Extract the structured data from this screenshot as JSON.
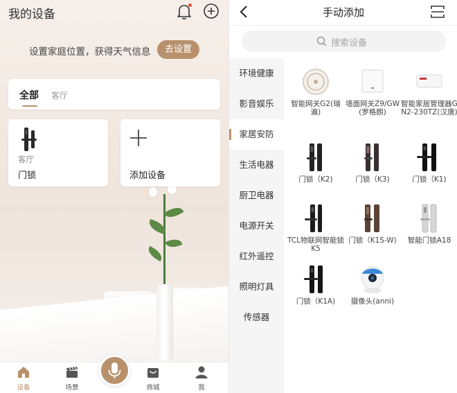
{
  "left": {
    "title": "我的设备",
    "location_prompt": "设置家庭位置，获得天气信息",
    "location_button": "去设置",
    "tabs": [
      {
        "label": "全部",
        "active": true
      },
      {
        "label": "客厅",
        "active": false
      }
    ],
    "devices": [
      {
        "room": "客厅",
        "name": "门锁",
        "icon": "door-lock"
      },
      {
        "name": "添加设备",
        "icon": "plus-icon"
      }
    ],
    "tabbar": [
      {
        "label": "设备",
        "icon": "home-icon",
        "active": true
      },
      {
        "label": "场景",
        "icon": "clapperboard-icon",
        "active": false
      },
      {
        "label": "",
        "icon": "microphone-icon",
        "active": false
      },
      {
        "label": "商城",
        "icon": "shopping-bag-icon",
        "active": false
      },
      {
        "label": "我",
        "icon": "person-icon",
        "active": false
      }
    ]
  },
  "right": {
    "title": "手动添加",
    "search_placeholder": "搜索设备",
    "categories": [
      {
        "label": "环境健康",
        "active": false
      },
      {
        "label": "影音娱乐",
        "active": false
      },
      {
        "label": "家居安防",
        "active": true
      },
      {
        "label": "生活电器",
        "active": false
      },
      {
        "label": "厨卫电器",
        "active": false
      },
      {
        "label": "电源开关",
        "active": false
      },
      {
        "label": "红外遥控",
        "active": false
      },
      {
        "label": "照明灯具",
        "active": false
      },
      {
        "label": "传感器",
        "active": false
      }
    ],
    "devices": [
      {
        "label": "智能网关G2(瑞瀛)",
        "icon": "gateway-round"
      },
      {
        "label": "墙面网关Z9/GW(罗格朗)",
        "icon": "wall-gateway"
      },
      {
        "label": "智能家居管理器GN2-230TZ(汉唐)",
        "icon": "home-manager"
      },
      {
        "label": "门锁（K2)",
        "icon": "door-lock"
      },
      {
        "label": "门锁（K3)",
        "icon": "door-lock"
      },
      {
        "label": "门锁（K1)",
        "icon": "door-lock"
      },
      {
        "label": "TCL物联网智能锁K5",
        "icon": "door-lock"
      },
      {
        "label": "门锁（K1S-W)",
        "icon": "door-lock-bronze"
      },
      {
        "label": "智能门锁A18",
        "icon": "door-lock-silver"
      },
      {
        "label": "门锁（K1A)",
        "icon": "door-lock"
      },
      {
        "label": "摄像头(anni)",
        "icon": "camera"
      }
    ]
  },
  "colors": {
    "accent": "#b8916c",
    "badge": "#e54b3c"
  }
}
